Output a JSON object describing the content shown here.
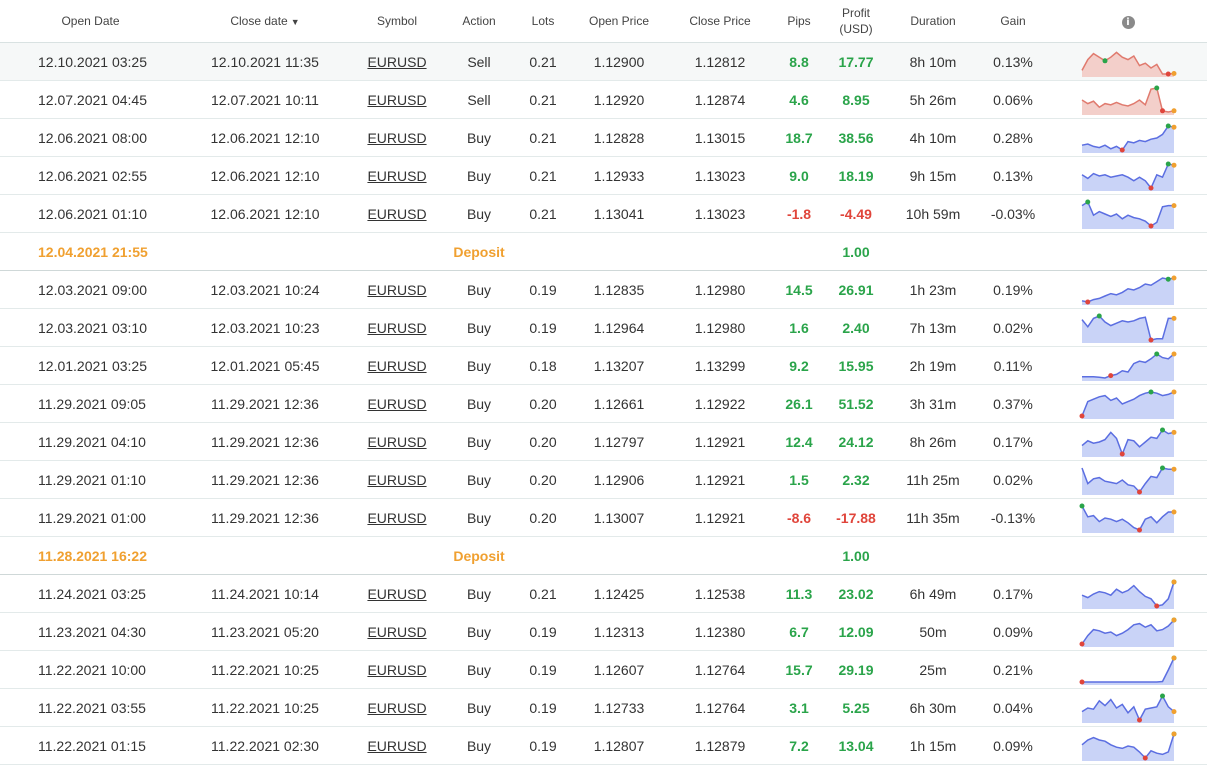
{
  "headers": {
    "open_date": "Open Date",
    "close_date": "Close date",
    "symbol": "Symbol",
    "action": "Action",
    "lots": "Lots",
    "open_price": "Open Price",
    "close_price": "Close Price",
    "pips": "Pips",
    "profit_line1": "Profit",
    "profit_line2": "(USD)",
    "duration": "Duration",
    "gain": "Gain",
    "info": "i"
  },
  "colors": {
    "positive": "#2aa44a",
    "negative": "#e0453b",
    "deposit": "#f0a030",
    "spark_buy": "#5b6ee1",
    "spark_sell": "#e07a6e"
  },
  "rows": [
    {
      "type": "trade",
      "open": "12.10.2021 03:25",
      "close": "12.10.2021 11:35",
      "symbol": "EURUSD",
      "action": "Sell",
      "lots": "0.21",
      "open_price": "1.12900",
      "close_price": "1.12812",
      "pips": "8.8",
      "profit": "17.77",
      "duration": "8h 10m",
      "gain": "0.13%",
      "sign": "pos",
      "spark": {
        "kind": "sell",
        "points": [
          0.15,
          0.6,
          0.85,
          0.7,
          0.55,
          0.7,
          0.9,
          0.7,
          0.6,
          0.75,
          0.35,
          0.45,
          0.25,
          0.4,
          0.0,
          0.0,
          0.02
        ],
        "max": 4,
        "min": 15
      }
    },
    {
      "type": "trade",
      "open": "12.07.2021 04:45",
      "close": "12.07.2021 10:11",
      "symbol": "EURUSD",
      "action": "Sell",
      "lots": "0.21",
      "open_price": "1.12920",
      "close_price": "1.12874",
      "pips": "4.6",
      "profit": "8.95",
      "duration": "5h 26m",
      "gain": "0.06%",
      "sign": "pos",
      "spark": {
        "kind": "sell",
        "points": [
          0.5,
          0.35,
          0.45,
          0.2,
          0.35,
          0.3,
          0.4,
          0.3,
          0.25,
          0.35,
          0.5,
          0.3,
          0.95,
          1.0,
          0.05,
          0.0,
          0.05
        ],
        "max": 13,
        "min": 14
      }
    },
    {
      "type": "trade",
      "open": "12.06.2021 08:00",
      "close": "12.06.2021 12:10",
      "symbol": "EURUSD",
      "action": "Buy",
      "lots": "0.21",
      "open_price": "1.12828",
      "close_price": "1.13015",
      "pips": "18.7",
      "profit": "38.56",
      "duration": "4h 10m",
      "gain": "0.28%",
      "sign": "pos",
      "spark": {
        "kind": "buy",
        "points": [
          0.2,
          0.25,
          0.15,
          0.1,
          0.2,
          0.05,
          0.15,
          0.0,
          0.35,
          0.3,
          0.4,
          0.35,
          0.45,
          0.5,
          0.65,
          1.0,
          0.95
        ],
        "max": 15,
        "min": 7
      }
    },
    {
      "type": "trade",
      "open": "12.06.2021 02:55",
      "close": "12.06.2021 12:10",
      "symbol": "EURUSD",
      "action": "Buy",
      "lots": "0.21",
      "open_price": "1.12933",
      "close_price": "1.13023",
      "pips": "9.0",
      "profit": "18.19",
      "duration": "9h 15m",
      "gain": "0.13%",
      "sign": "pos",
      "spark": {
        "kind": "buy",
        "points": [
          0.55,
          0.4,
          0.6,
          0.5,
          0.55,
          0.45,
          0.5,
          0.55,
          0.45,
          0.3,
          0.45,
          0.3,
          0.0,
          0.55,
          0.45,
          1.0,
          0.95
        ],
        "max": 15,
        "min": 12
      }
    },
    {
      "type": "trade",
      "open": "12.06.2021 01:10",
      "close": "12.06.2021 12:10",
      "symbol": "EURUSD",
      "action": "Buy",
      "lots": "0.21",
      "open_price": "1.13041",
      "close_price": "1.13023",
      "pips": "-1.8",
      "profit": "-4.49",
      "duration": "10h 59m",
      "gain": "-0.03%",
      "sign": "neg",
      "spark": {
        "kind": "buy",
        "points": [
          0.85,
          1.0,
          0.45,
          0.6,
          0.5,
          0.4,
          0.5,
          0.3,
          0.45,
          0.35,
          0.3,
          0.2,
          0.0,
          0.15,
          0.8,
          0.85,
          0.85
        ],
        "max": 1,
        "min": 12
      }
    },
    {
      "type": "deposit",
      "date": "12.04.2021 21:55",
      "label": "Deposit",
      "amount": "1.00"
    },
    {
      "type": "trade",
      "open": "12.03.2021 09:00",
      "close": "12.03.2021 10:24",
      "symbol": "EURUSD",
      "action": "Buy",
      "lots": "0.19",
      "open_price": "1.12835",
      "close_price": "1.12980",
      "pips": "14.5",
      "profit": "26.91",
      "duration": "1h 23m",
      "gain": "0.19%",
      "sign": "pos",
      "spark": {
        "kind": "buy",
        "points": [
          0.05,
          0.0,
          0.1,
          0.15,
          0.25,
          0.35,
          0.3,
          0.4,
          0.55,
          0.5,
          0.6,
          0.75,
          0.7,
          0.85,
          1.0,
          0.95,
          1.0
        ],
        "max": 15,
        "min": 1
      }
    },
    {
      "type": "trade",
      "open": "12.03.2021 03:10",
      "close": "12.03.2021 10:23",
      "symbol": "EURUSD",
      "action": "Buy",
      "lots": "0.19",
      "open_price": "1.12964",
      "close_price": "1.12980",
      "pips": "1.6",
      "profit": "2.40",
      "duration": "7h 13m",
      "gain": "0.02%",
      "sign": "pos",
      "spark": {
        "kind": "buy",
        "points": [
          0.85,
          0.55,
          0.9,
          1.0,
          0.75,
          0.6,
          0.7,
          0.8,
          0.75,
          0.8,
          0.9,
          0.95,
          0.0,
          0.05,
          0.05,
          0.9,
          0.9
        ],
        "max": 3,
        "min": 12
      }
    },
    {
      "type": "trade",
      "open": "12.01.2021 03:25",
      "close": "12.01.2021 05:45",
      "symbol": "EURUSD",
      "action": "Buy",
      "lots": "0.18",
      "open_price": "1.13207",
      "close_price": "1.13299",
      "pips": "9.2",
      "profit": "15.95",
      "duration": "2h 19m",
      "gain": "0.11%",
      "sign": "pos",
      "spark": {
        "kind": "buy",
        "points": [
          0.05,
          0.05,
          0.05,
          0.03,
          0.0,
          0.1,
          0.15,
          0.3,
          0.25,
          0.6,
          0.7,
          0.65,
          0.8,
          1.0,
          0.85,
          0.8,
          1.0
        ],
        "max": 13,
        "min": 5
      }
    },
    {
      "type": "trade",
      "open": "11.29.2021 09:05",
      "close": "11.29.2021 12:36",
      "symbol": "EURUSD",
      "action": "Buy",
      "lots": "0.20",
      "open_price": "1.12661",
      "close_price": "1.12922",
      "pips": "26.1",
      "profit": "51.52",
      "duration": "3h 31m",
      "gain": "0.37%",
      "sign": "pos",
      "spark": {
        "kind": "buy",
        "points": [
          0.0,
          0.6,
          0.7,
          0.8,
          0.85,
          0.65,
          0.75,
          0.5,
          0.6,
          0.7,
          0.85,
          0.95,
          1.0,
          0.95,
          0.85,
          0.9,
          1.0
        ],
        "max": 12,
        "min": 0
      }
    },
    {
      "type": "trade",
      "open": "11.29.2021 04:10",
      "close": "11.29.2021 12:36",
      "symbol": "EURUSD",
      "action": "Buy",
      "lots": "0.20",
      "open_price": "1.12797",
      "close_price": "1.12921",
      "pips": "12.4",
      "profit": "24.12",
      "duration": "8h 26m",
      "gain": "0.17%",
      "sign": "pos",
      "spark": {
        "kind": "buy",
        "points": [
          0.35,
          0.55,
          0.45,
          0.5,
          0.6,
          0.9,
          0.65,
          0.0,
          0.6,
          0.55,
          0.3,
          0.5,
          0.7,
          0.65,
          1.0,
          0.85,
          0.9
        ],
        "max": 14,
        "min": 7
      }
    },
    {
      "type": "trade",
      "open": "11.29.2021 01:10",
      "close": "11.29.2021 12:36",
      "symbol": "EURUSD",
      "action": "Buy",
      "lots": "0.20",
      "open_price": "1.12906",
      "close_price": "1.12921",
      "pips": "1.5",
      "profit": "2.32",
      "duration": "11h 25m",
      "gain": "0.02%",
      "sign": "pos",
      "spark": {
        "kind": "buy",
        "points": [
          1.0,
          0.35,
          0.55,
          0.6,
          0.45,
          0.4,
          0.35,
          0.5,
          0.3,
          0.25,
          0.0,
          0.35,
          0.65,
          0.6,
          1.0,
          0.95,
          0.95
        ],
        "max": 14,
        "min": 10
      }
    },
    {
      "type": "trade",
      "open": "11.29.2021 01:00",
      "close": "11.29.2021 12:36",
      "symbol": "EURUSD",
      "action": "Buy",
      "lots": "0.20",
      "open_price": "1.13007",
      "close_price": "1.12921",
      "pips": "-8.6",
      "profit": "-17.88",
      "duration": "11h 35m",
      "gain": "-0.13%",
      "sign": "neg",
      "spark": {
        "kind": "buy",
        "points": [
          1.0,
          0.55,
          0.6,
          0.35,
          0.5,
          0.45,
          0.35,
          0.45,
          0.3,
          0.1,
          0.0,
          0.45,
          0.55,
          0.3,
          0.55,
          0.75,
          0.75
        ],
        "max": 0,
        "min": 10
      }
    },
    {
      "type": "deposit",
      "date": "11.28.2021 16:22",
      "label": "Deposit",
      "amount": "1.00"
    },
    {
      "type": "trade",
      "open": "11.24.2021 03:25",
      "close": "11.24.2021 10:14",
      "symbol": "EURUSD",
      "action": "Buy",
      "lots": "0.21",
      "open_price": "1.12425",
      "close_price": "1.12538",
      "pips": "11.3",
      "profit": "23.02",
      "duration": "6h 49m",
      "gain": "0.17%",
      "sign": "pos",
      "spark": {
        "kind": "buy",
        "points": [
          0.45,
          0.35,
          0.5,
          0.6,
          0.55,
          0.45,
          0.7,
          0.55,
          0.65,
          0.85,
          0.6,
          0.4,
          0.3,
          0.0,
          0.05,
          0.3,
          1.0
        ],
        "max": 16,
        "min": 13
      }
    },
    {
      "type": "trade",
      "open": "11.23.2021 04:30",
      "close": "11.23.2021 05:20",
      "symbol": "EURUSD",
      "action": "Buy",
      "lots": "0.19",
      "open_price": "1.12313",
      "close_price": "1.12380",
      "pips": "6.7",
      "profit": "12.09",
      "duration": "50m",
      "gain": "0.09%",
      "sign": "pos",
      "spark": {
        "kind": "buy",
        "points": [
          0.0,
          0.35,
          0.6,
          0.55,
          0.45,
          0.5,
          0.35,
          0.45,
          0.6,
          0.8,
          0.85,
          0.7,
          0.8,
          0.55,
          0.6,
          0.75,
          1.0
        ],
        "max": 16,
        "min": 0
      }
    },
    {
      "type": "trade",
      "open": "11.22.2021 10:00",
      "close": "11.22.2021 10:25",
      "symbol": "EURUSD",
      "action": "Buy",
      "lots": "0.19",
      "open_price": "1.12607",
      "close_price": "1.12764",
      "pips": "15.7",
      "profit": "29.19",
      "duration": "25m",
      "gain": "0.21%",
      "sign": "pos",
      "spark": {
        "kind": "buy",
        "points": [
          0.0,
          0.0,
          0.0,
          0.0,
          0.0,
          0.0,
          0.0,
          0.0,
          0.0,
          0.0,
          0.0,
          0.0,
          0.0,
          0.0,
          0.02,
          0.5,
          1.0
        ],
        "max": 16,
        "min": 0
      }
    },
    {
      "type": "trade",
      "open": "11.22.2021 03:55",
      "close": "11.22.2021 10:25",
      "symbol": "EURUSD",
      "action": "Buy",
      "lots": "0.19",
      "open_price": "1.12733",
      "close_price": "1.12764",
      "pips": "3.1",
      "profit": "5.25",
      "duration": "6h 30m",
      "gain": "0.04%",
      "sign": "pos",
      "spark": {
        "kind": "buy",
        "points": [
          0.35,
          0.5,
          0.45,
          0.8,
          0.6,
          0.85,
          0.5,
          0.65,
          0.3,
          0.55,
          0.0,
          0.45,
          0.5,
          0.55,
          1.0,
          0.55,
          0.35
        ],
        "max": 14,
        "min": 10
      }
    },
    {
      "type": "trade",
      "open": "11.22.2021 01:15",
      "close": "11.22.2021 02:30",
      "symbol": "EURUSD",
      "action": "Buy",
      "lots": "0.19",
      "open_price": "1.12807",
      "close_price": "1.12879",
      "pips": "7.2",
      "profit": "13.04",
      "duration": "1h 15m",
      "gain": "0.09%",
      "sign": "pos",
      "spark": {
        "kind": "buy",
        "points": [
          0.55,
          0.75,
          0.85,
          0.75,
          0.7,
          0.55,
          0.45,
          0.4,
          0.5,
          0.45,
          0.25,
          0.0,
          0.3,
          0.2,
          0.15,
          0.25,
          1.0
        ],
        "max": 16,
        "min": 11
      }
    }
  ]
}
